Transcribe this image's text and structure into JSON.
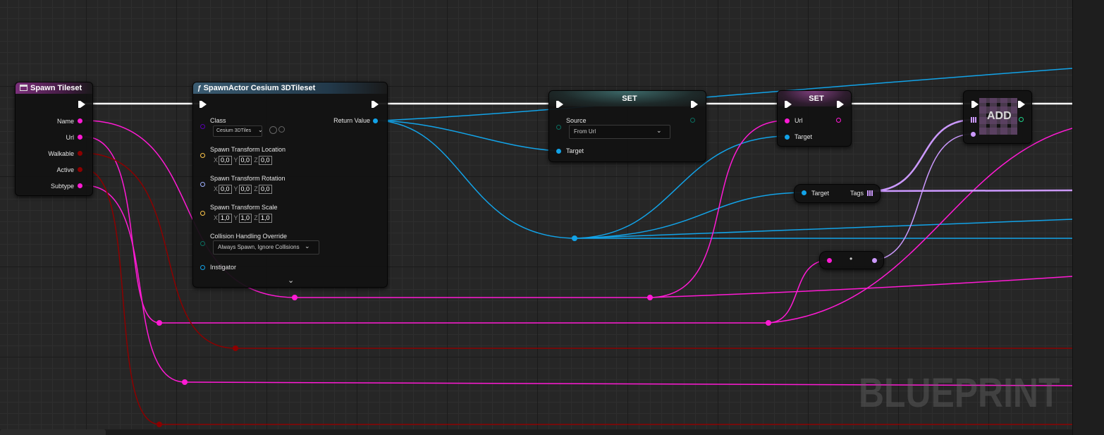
{
  "watermark": "BLUEPRINT",
  "nodes": {
    "spawn_tileset": {
      "title": "Spawn Tileset",
      "pins": [
        "Name",
        "Url",
        "Walkable",
        "Active",
        "Subtype"
      ]
    },
    "spawn_actor": {
      "title": "SpawnActor Cesium 3DTileset",
      "class_label": "Class",
      "class_value": "Cesium 3DTiles",
      "return_label": "Return Value",
      "location_label": "Spawn Transform Location",
      "location": {
        "x": "0,0",
        "y": "0,0",
        "z": "0,0"
      },
      "rotation_label": "Spawn Transform Rotation",
      "rotation": {
        "x": "0,0",
        "y": "0,0",
        "z": "0,0"
      },
      "scale_label": "Spawn Transform Scale",
      "scale": {
        "x": "1,0",
        "y": "1,0",
        "z": "1,0"
      },
      "collision_label": "Collision Handling Override",
      "collision_value": "Always Spawn, Ignore Collisions",
      "instigator_label": "Instigator",
      "axis": {
        "x": "X",
        "y": "Y",
        "z": "Z"
      }
    },
    "set_source": {
      "title": "SET",
      "source_label": "Source",
      "source_value": "From Url",
      "target_label": "Target"
    },
    "set_url": {
      "title": "SET",
      "url_label": "Url",
      "target_label": "Target"
    },
    "get_tags": {
      "target_label": "Target",
      "tags_label": "Tags"
    },
    "add_node": {
      "title": "ADD"
    },
    "convert_node": {
      "symbol": "•"
    }
  },
  "colors": {
    "string": "#ff1ad4",
    "object": "#12a3e8",
    "bool": "#8c0000",
    "name": "#cc99ff",
    "exec": "#ffffff",
    "vector": "#fdc64a",
    "rotator": "#9fb1ff",
    "enum": "#0a6e60",
    "class": "#5800b0"
  }
}
